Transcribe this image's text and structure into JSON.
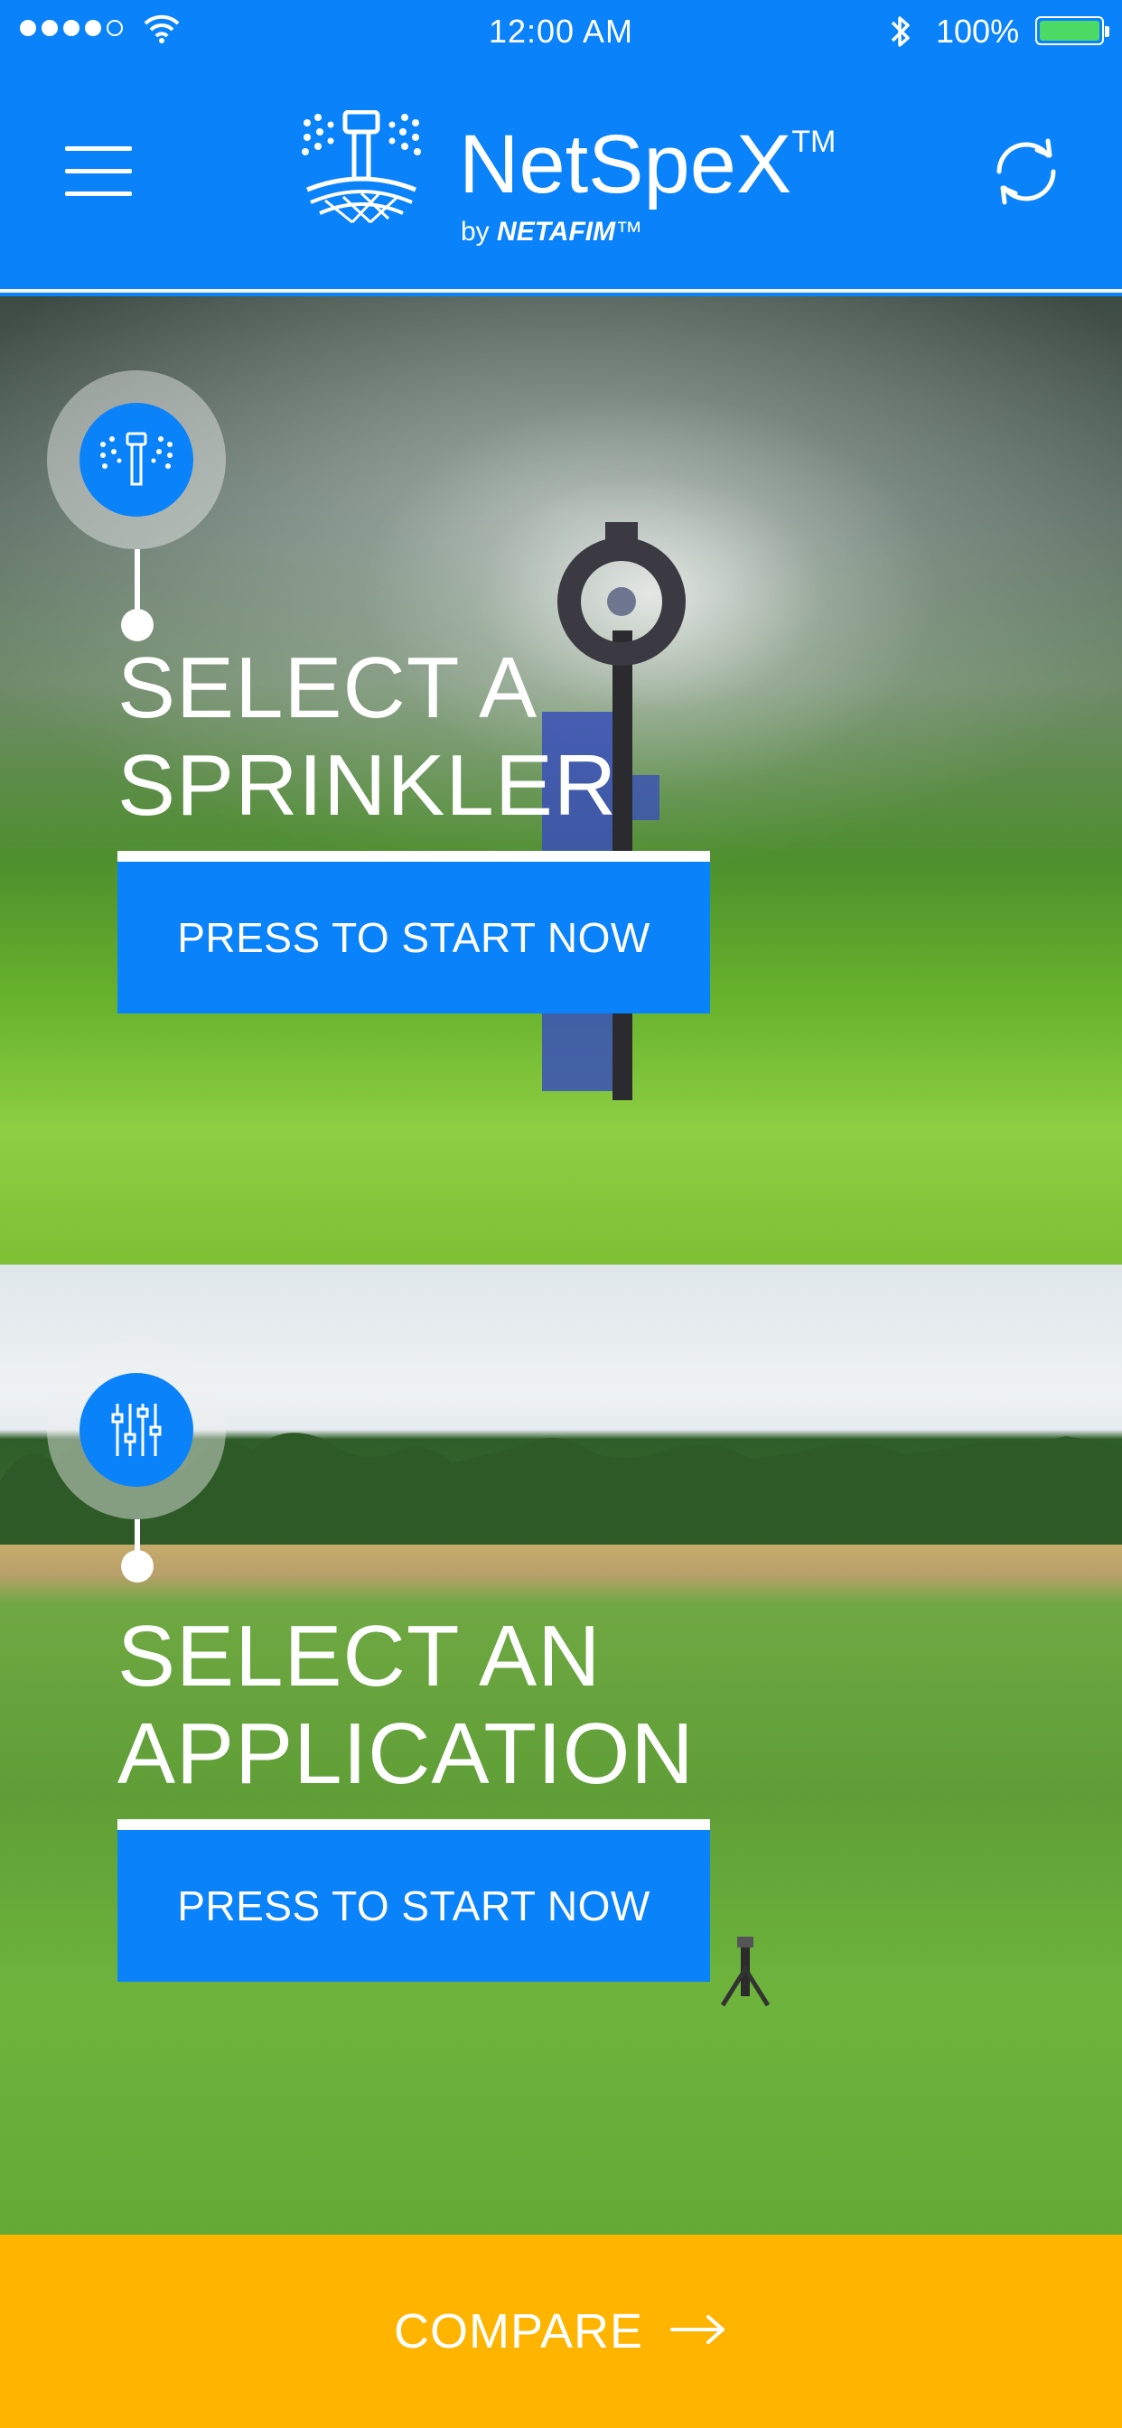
{
  "status_bar": {
    "time": "12:00 AM",
    "battery_percent": "100%",
    "battery_level": 1.0,
    "signal_bars_filled": 4,
    "signal_bars_total": 5,
    "icons": [
      "signal-dots-icon",
      "wifi-icon",
      "bluetooth-icon",
      "battery-icon"
    ]
  },
  "header": {
    "brand_name": "NetSpeX",
    "brand_tm": "TM",
    "brand_by": "by",
    "brand_company": "NETAFIM",
    "brand_company_tm": "™",
    "icons": [
      "hamburger-menu-icon",
      "netspex-logo-icon",
      "refresh-icon"
    ]
  },
  "steps": [
    {
      "title_line1": "SELECT A",
      "title_line2": "SPRINKLER",
      "cta_label": "PRESS TO START NOW",
      "icon": "sprinkler-icon"
    },
    {
      "title_line1": "SELECT AN",
      "title_line2": "APPLICATION",
      "cta_label": "PRESS TO START NOW",
      "icon": "sliders-icon"
    }
  ],
  "footer": {
    "compare_label": "COMPARE",
    "icon": "arrow-right-icon"
  },
  "colors": {
    "primary_blue": "#0a82fa",
    "compare_yellow": "#ffb400",
    "battery_green": "#4cd964",
    "white": "#ffffff"
  }
}
